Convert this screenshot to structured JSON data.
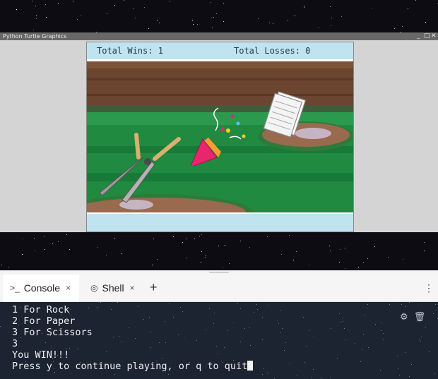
{
  "turtle_window": {
    "title": "Python Turtle Graphics",
    "controls": {
      "minimize": "_",
      "maximize": "□",
      "close": "✕"
    },
    "scoreboard": {
      "wins_label": "Total Wins: 1",
      "losses_label": "Total Losses: 0"
    },
    "scene_icons": [
      "hedge-shears-icon",
      "party-popper-icon",
      "paper-stack-icon"
    ]
  },
  "tabs": [
    {
      "label": "Console",
      "icon": "terminal-icon",
      "active": true,
      "close": "×"
    },
    {
      "label": "Shell",
      "icon": "shell-icon",
      "active": false,
      "close": "×"
    }
  ],
  "add_tab": "+",
  "menu": "⋮",
  "console": {
    "lines": [
      "1 For Rock",
      "2 For Paper",
      "3 For Scissors",
      "3",
      "You WIN!!!"
    ],
    "prompt": "Press y to continue playing, or q to quit"
  },
  "colors": {
    "console_bg": "#1c2331",
    "score_bar": "#bfe3ef",
    "grass": "#1f8a40"
  }
}
